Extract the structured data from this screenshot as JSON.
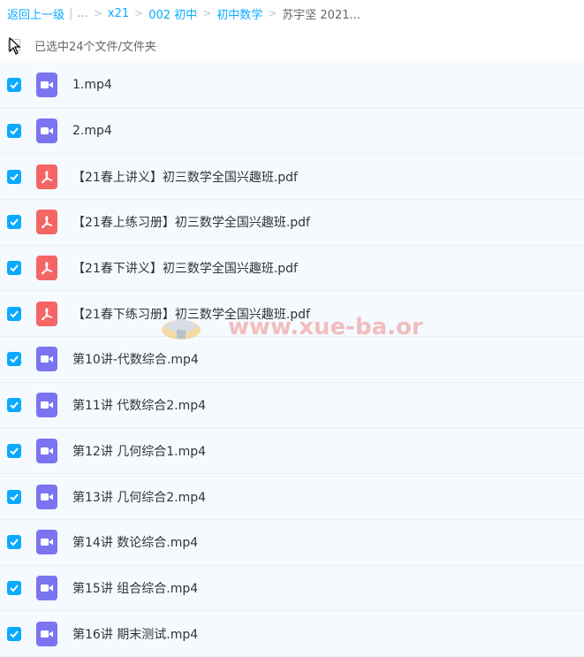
{
  "breadcrumb": {
    "back": "返回上一级",
    "ellipsis": "...",
    "items": [
      "x21",
      "002 初中",
      "初中数学"
    ],
    "current": "苏宇坚 2021..."
  },
  "selection": {
    "label": "已选中24个文件/文件夹"
  },
  "files": [
    {
      "name": "1.mp4",
      "type": "video"
    },
    {
      "name": "2.mp4",
      "type": "video"
    },
    {
      "name": "【21春上讲义】初三数学全国兴趣班.pdf",
      "type": "pdf"
    },
    {
      "name": "【21春上练习册】初三数学全国兴趣班.pdf",
      "type": "pdf"
    },
    {
      "name": "【21春下讲义】初三数学全国兴趣班.pdf",
      "type": "pdf"
    },
    {
      "name": "【21春下练习册】初三数学全国兴趣班.pdf",
      "type": "pdf"
    },
    {
      "name": "第10讲-代数综合.mp4",
      "type": "video"
    },
    {
      "name": "第11讲 代数综合2.mp4",
      "type": "video"
    },
    {
      "name": "第12讲 几何综合1.mp4",
      "type": "video"
    },
    {
      "name": "第13讲 几何综合2.mp4",
      "type": "video"
    },
    {
      "name": "第14讲 数论综合.mp4",
      "type": "video"
    },
    {
      "name": "第15讲 组合综合.mp4",
      "type": "video"
    },
    {
      "name": "第16讲 期末测试.mp4",
      "type": "video"
    }
  ],
  "watermark": {
    "text": "www.xue-ba.org"
  },
  "colors": {
    "accent": "#09aaff",
    "video_icon": "#7b74f0",
    "pdf_icon": "#f56565",
    "row_bg": "#f5faff"
  }
}
